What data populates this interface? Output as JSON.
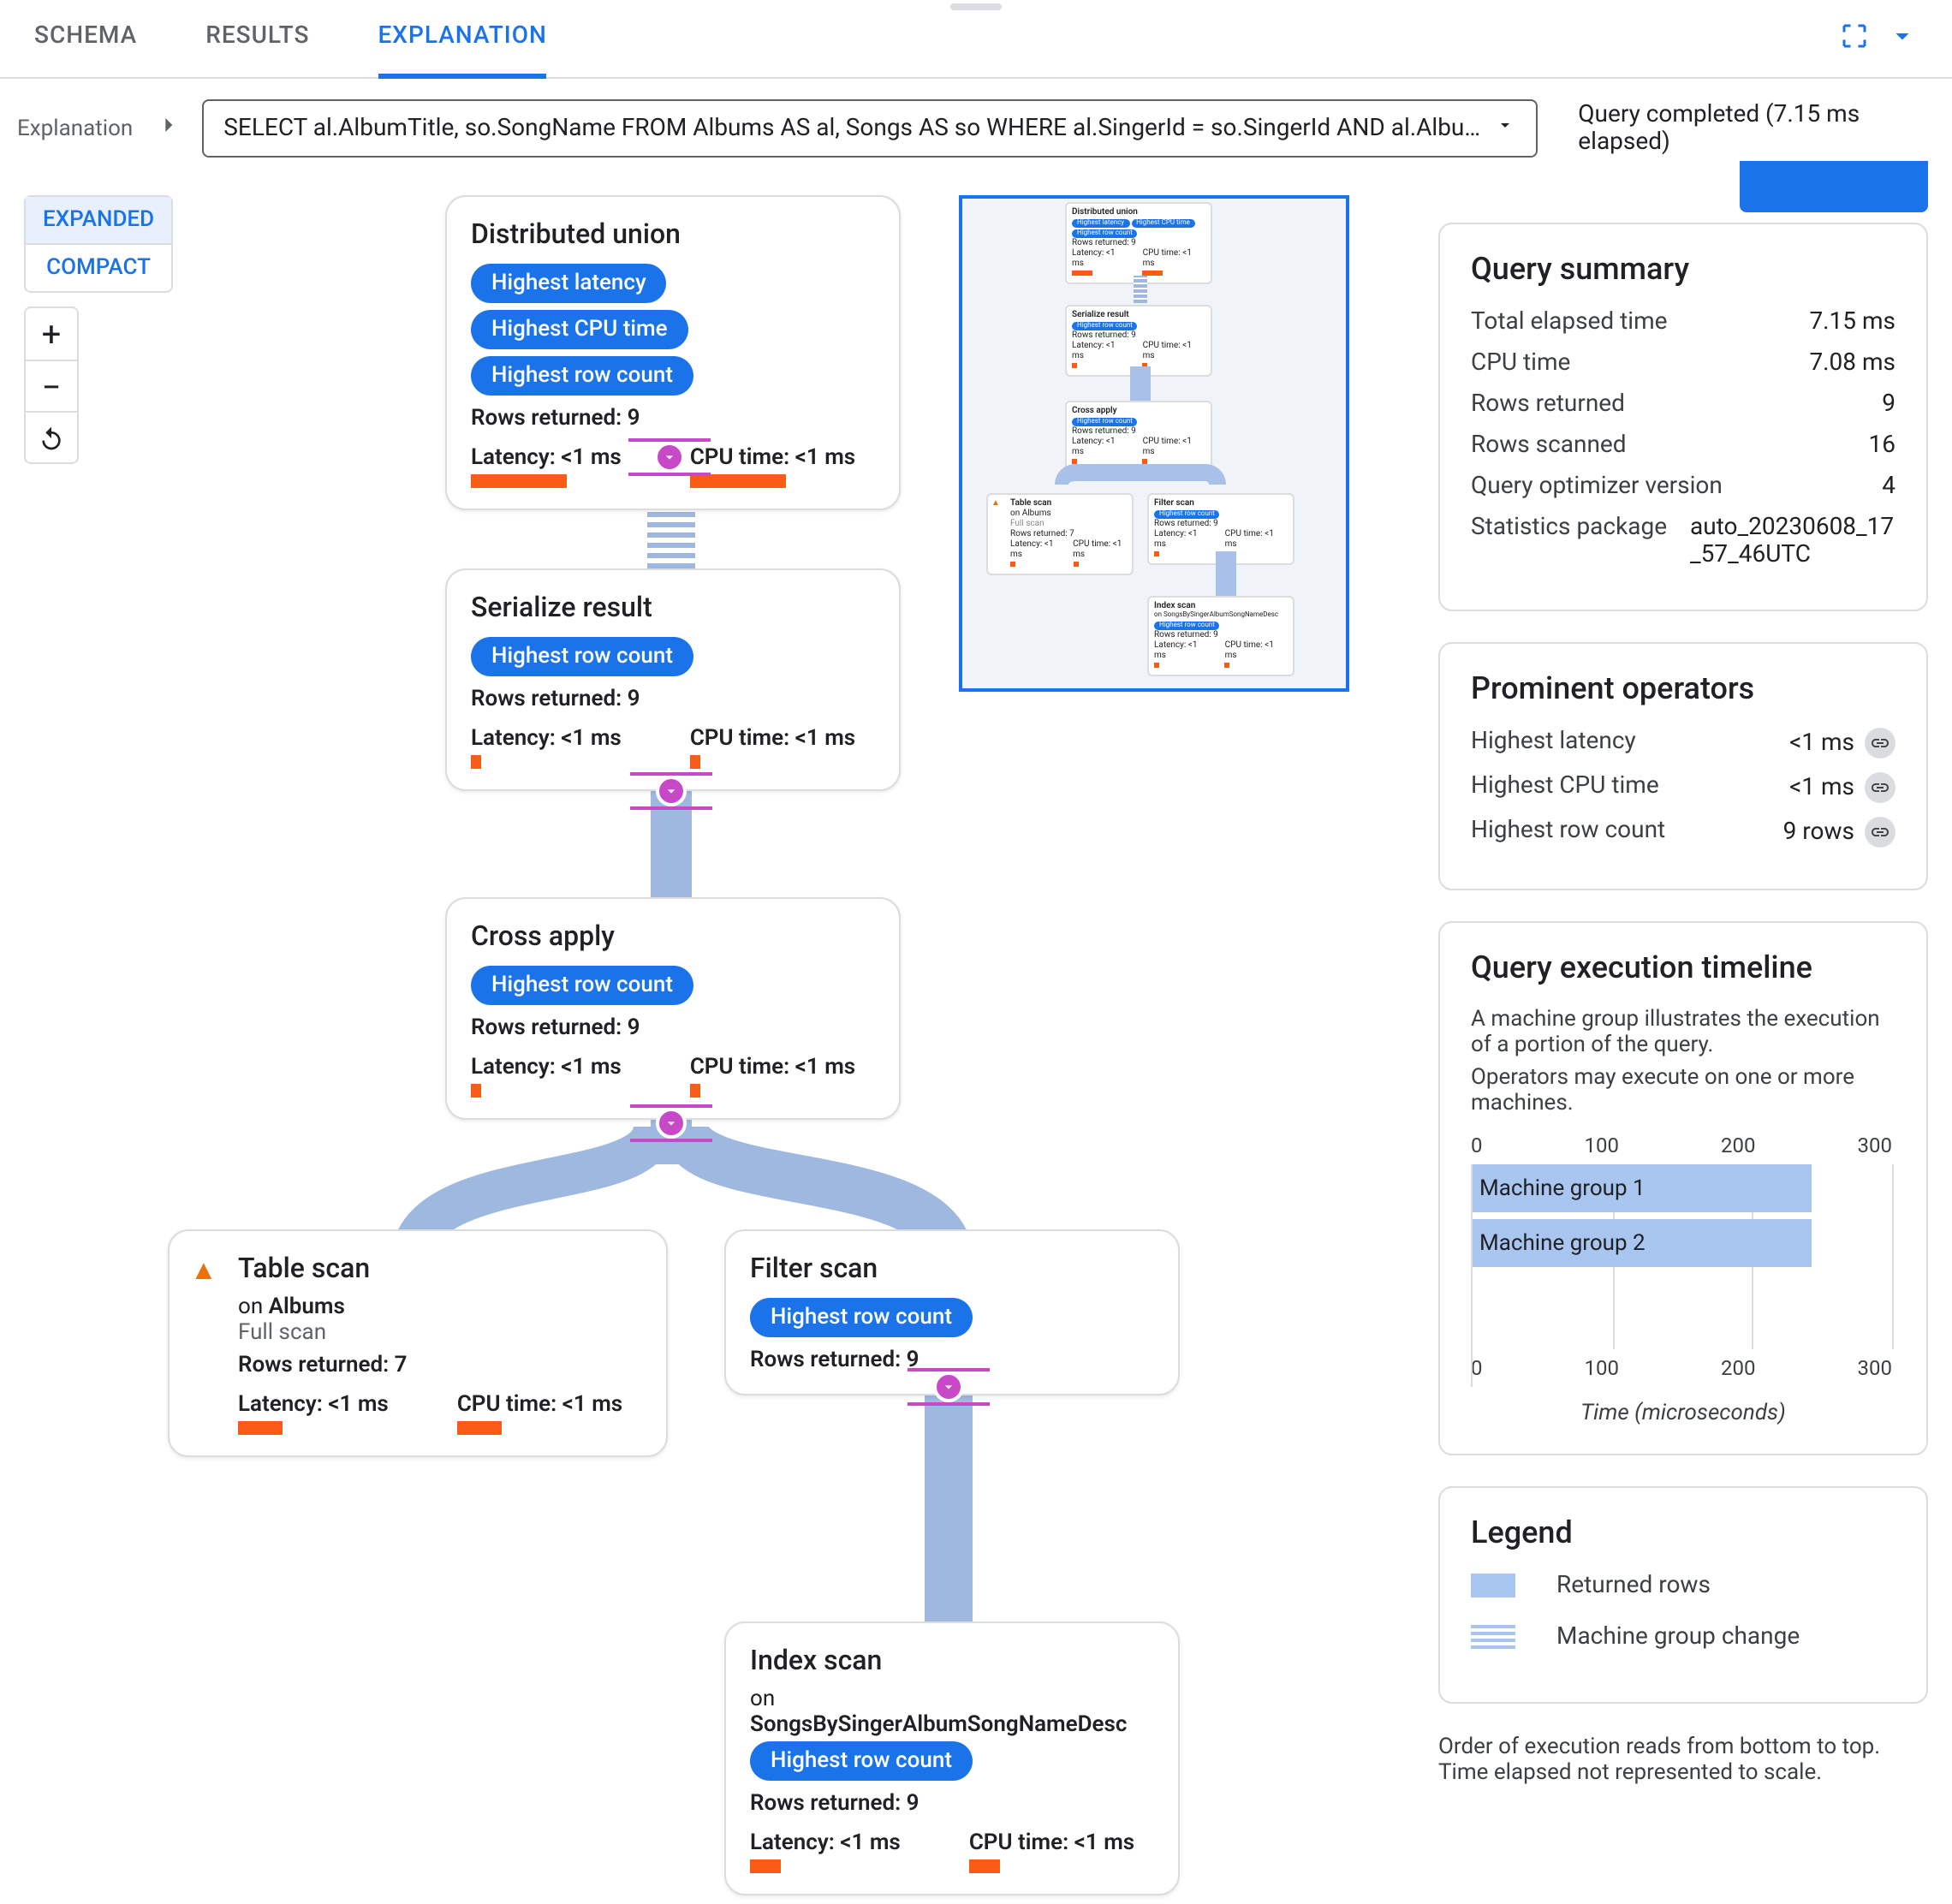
{
  "tabs": {
    "schema": "SCHEMA",
    "results": "RESULTS",
    "explanation": "EXPLANATION"
  },
  "explain": {
    "label": "Explanation",
    "query": "SELECT al.AlbumTitle, so.SongName FROM Albums AS al, Songs AS so WHERE al.SingerId = so.SingerId AND al.AlbumId = so.Alb…",
    "status": "Query completed (7.15 ms elapsed)"
  },
  "toggles": {
    "expanded": "EXPANDED",
    "compact": "COMPACT"
  },
  "nodes": {
    "du": {
      "title": "Distributed union",
      "pills": [
        "Highest latency",
        "Highest CPU time",
        "Highest row count"
      ],
      "rows": "Rows returned: 9",
      "lat": "Latency: <1 ms",
      "cpu": "CPU time: <1 ms"
    },
    "sr": {
      "title": "Serialize result",
      "pills": [
        "Highest row count"
      ],
      "rows": "Rows returned: 9",
      "lat": "Latency: <1 ms",
      "cpu": "CPU time: <1 ms"
    },
    "ca": {
      "title": "Cross apply",
      "pills": [
        "Highest row count"
      ],
      "rows": "Rows returned: 9",
      "lat": "Latency: <1 ms",
      "cpu": "CPU time: <1 ms"
    },
    "ts": {
      "title": "Table scan",
      "on": "on ",
      "target": "Albums",
      "mode": "Full scan",
      "rows": "Rows returned: 7",
      "lat": "Latency: <1 ms",
      "cpu": "CPU time: <1 ms"
    },
    "fs": {
      "title": "Filter scan",
      "pills": [
        "Highest row count"
      ],
      "rows": "Rows returned: 9"
    },
    "is": {
      "title": "Index scan",
      "on": "on ",
      "target": "SongsBySingerAlbumSongNameDesc",
      "pills": [
        "Highest row count"
      ],
      "rows": "Rows returned: 9",
      "lat": "Latency: <1 ms",
      "cpu": "CPU time: <1 ms"
    }
  },
  "summary": {
    "title": "Query summary",
    "items": [
      {
        "k": "Total elapsed time",
        "v": "7.15 ms"
      },
      {
        "k": "CPU time",
        "v": "7.08 ms"
      },
      {
        "k": "Rows returned",
        "v": "9"
      },
      {
        "k": "Rows scanned",
        "v": "16"
      },
      {
        "k": "Query optimizer version",
        "v": "4"
      },
      {
        "k": "Statistics package",
        "v": "auto_20230608_17_57_46UTC"
      }
    ]
  },
  "prominent": {
    "title": "Prominent operators",
    "items": [
      {
        "k": "Highest latency",
        "v": "<1 ms"
      },
      {
        "k": "Highest CPU time",
        "v": "<1 ms"
      },
      {
        "k": "Highest row count",
        "v": "9 rows"
      }
    ]
  },
  "timeline": {
    "title": "Query execution timeline",
    "desc1": "A machine group illustrates the execution of a portion of the query.",
    "desc2": "Operators may execute on one or more machines.",
    "xlabel": "Time (microseconds)",
    "ticks": [
      "0",
      "100",
      "200",
      "300"
    ]
  },
  "chart_data": {
    "type": "bar",
    "categories": [
      "Machine group 1",
      "Machine group 2"
    ],
    "values": [
      250,
      250
    ],
    "xlabel": "Time (microseconds)",
    "ylabel": "",
    "xlim": [
      0,
      300
    ]
  },
  "legend": {
    "title": "Legend",
    "returned": "Returned rows",
    "change": "Machine group change"
  },
  "footnote": {
    "l1": "Order of execution reads from bottom to top.",
    "l2": "Time elapsed not represented to scale."
  }
}
